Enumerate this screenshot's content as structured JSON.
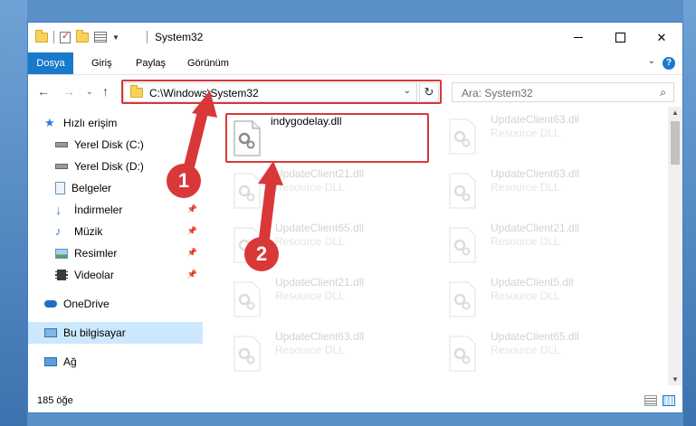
{
  "titlebar": {
    "title": "System32"
  },
  "ribbon": {
    "tabs": [
      "Dosya",
      "Giriş",
      "Paylaş",
      "Görünüm"
    ],
    "help": "?"
  },
  "address": {
    "path": "C:\\Windows\\System32"
  },
  "search": {
    "placeholder": "Ara: System32"
  },
  "sidebar": {
    "items": [
      {
        "label": "Hızlı erişim",
        "icon": "star-icon",
        "pinned": false
      },
      {
        "label": "Yerel Disk (C:)",
        "icon": "drive-icon",
        "pinned": false
      },
      {
        "label": "Yerel Disk (D:)",
        "icon": "drive-icon",
        "pinned": false
      },
      {
        "label": "Belgeler",
        "icon": "document-icon",
        "pinned": false
      },
      {
        "label": "İndirmeler",
        "icon": "download-icon",
        "pinned": true
      },
      {
        "label": "Müzik",
        "icon": "music-icon",
        "pinned": true
      },
      {
        "label": "Resimler",
        "icon": "picture-icon",
        "pinned": true
      },
      {
        "label": "Videolar",
        "icon": "video-icon",
        "pinned": true
      },
      {
        "label": "OneDrive",
        "icon": "cloud-icon",
        "pinned": false
      },
      {
        "label": "Bu bilgisayar",
        "icon": "computer-icon",
        "pinned": false
      },
      {
        "label": "Ağ",
        "icon": "network-icon",
        "pinned": false
      }
    ]
  },
  "files": {
    "highlighted": {
      "name": "indygodelay.dll",
      "desc": ""
    },
    "left": [
      {
        "name": "UpdateClient21.dll",
        "desc": "Resource DLL"
      },
      {
        "name": "UpdateClient65.dll",
        "desc": "Resource DLL"
      },
      {
        "name": "UpdateClient21.dll",
        "desc": "Resource DLL"
      },
      {
        "name": "UpdateClient63.dll",
        "desc": "Resource DLL"
      }
    ],
    "right": [
      {
        "name": "UpdateClient63.dll",
        "desc": "Resource DLL"
      },
      {
        "name": "UpdateClient63.dll",
        "desc": "Resource DLL"
      },
      {
        "name": "UpdateClient21.dll",
        "desc": "Resource DLL"
      },
      {
        "name": "UpdateClient5.dll",
        "desc": "Resource DLL"
      },
      {
        "name": "UpdateClient65.dll",
        "desc": "Resource DLL"
      }
    ]
  },
  "status": {
    "count": "185 öğe"
  },
  "annotations": {
    "badge1": "1",
    "badge2": "2"
  },
  "colors": {
    "accent": "#1979ca",
    "highlight": "#d93838",
    "selected": "#cce8ff"
  }
}
